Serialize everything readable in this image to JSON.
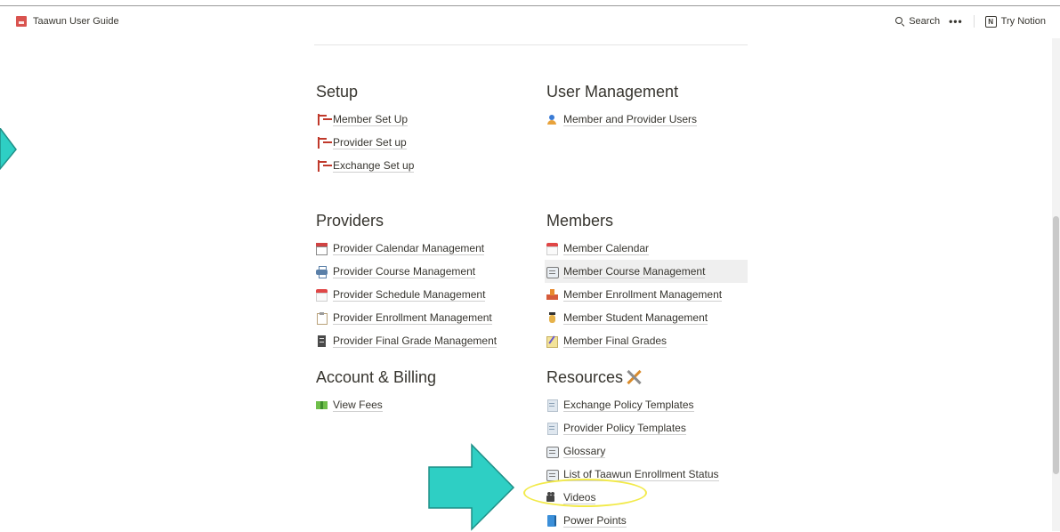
{
  "topbar": {
    "title": "Taawun User Guide",
    "search_label": "Search",
    "more_label": "•••",
    "try_notion_label": "Try Notion"
  },
  "sections": [
    {
      "heading": "Setup",
      "items": [
        "Member Set Up",
        "Provider Set up",
        "Exchange Set up"
      ]
    },
    {
      "heading": "User Management",
      "items": [
        "Member and Provider Users"
      ]
    },
    {
      "heading": "Providers",
      "items": [
        "Provider Calendar Management",
        "Provider Course Management",
        "Provider Schedule Management",
        "Provider Enrollment Management",
        "Provider Final Grade Management"
      ]
    },
    {
      "heading": "Members",
      "items": [
        "Member Calendar",
        "Member Course Management",
        "Member Enrollment Management",
        "Member Student Management",
        "Member Final Grades"
      ]
    },
    {
      "heading": "Account & Billing",
      "items": [
        "View Fees"
      ]
    },
    {
      "heading": "Resources",
      "items": [
        "Exchange Policy Templates",
        "Provider Policy Templates",
        "Glossary",
        "List of Taawun Enrollment Status",
        "Videos",
        "Power Points"
      ]
    }
  ],
  "colors": {
    "annotation_arrow": "#2ecfc4",
    "annotation_highlight": "#f2ea4a",
    "hover_row": "#efefef"
  }
}
